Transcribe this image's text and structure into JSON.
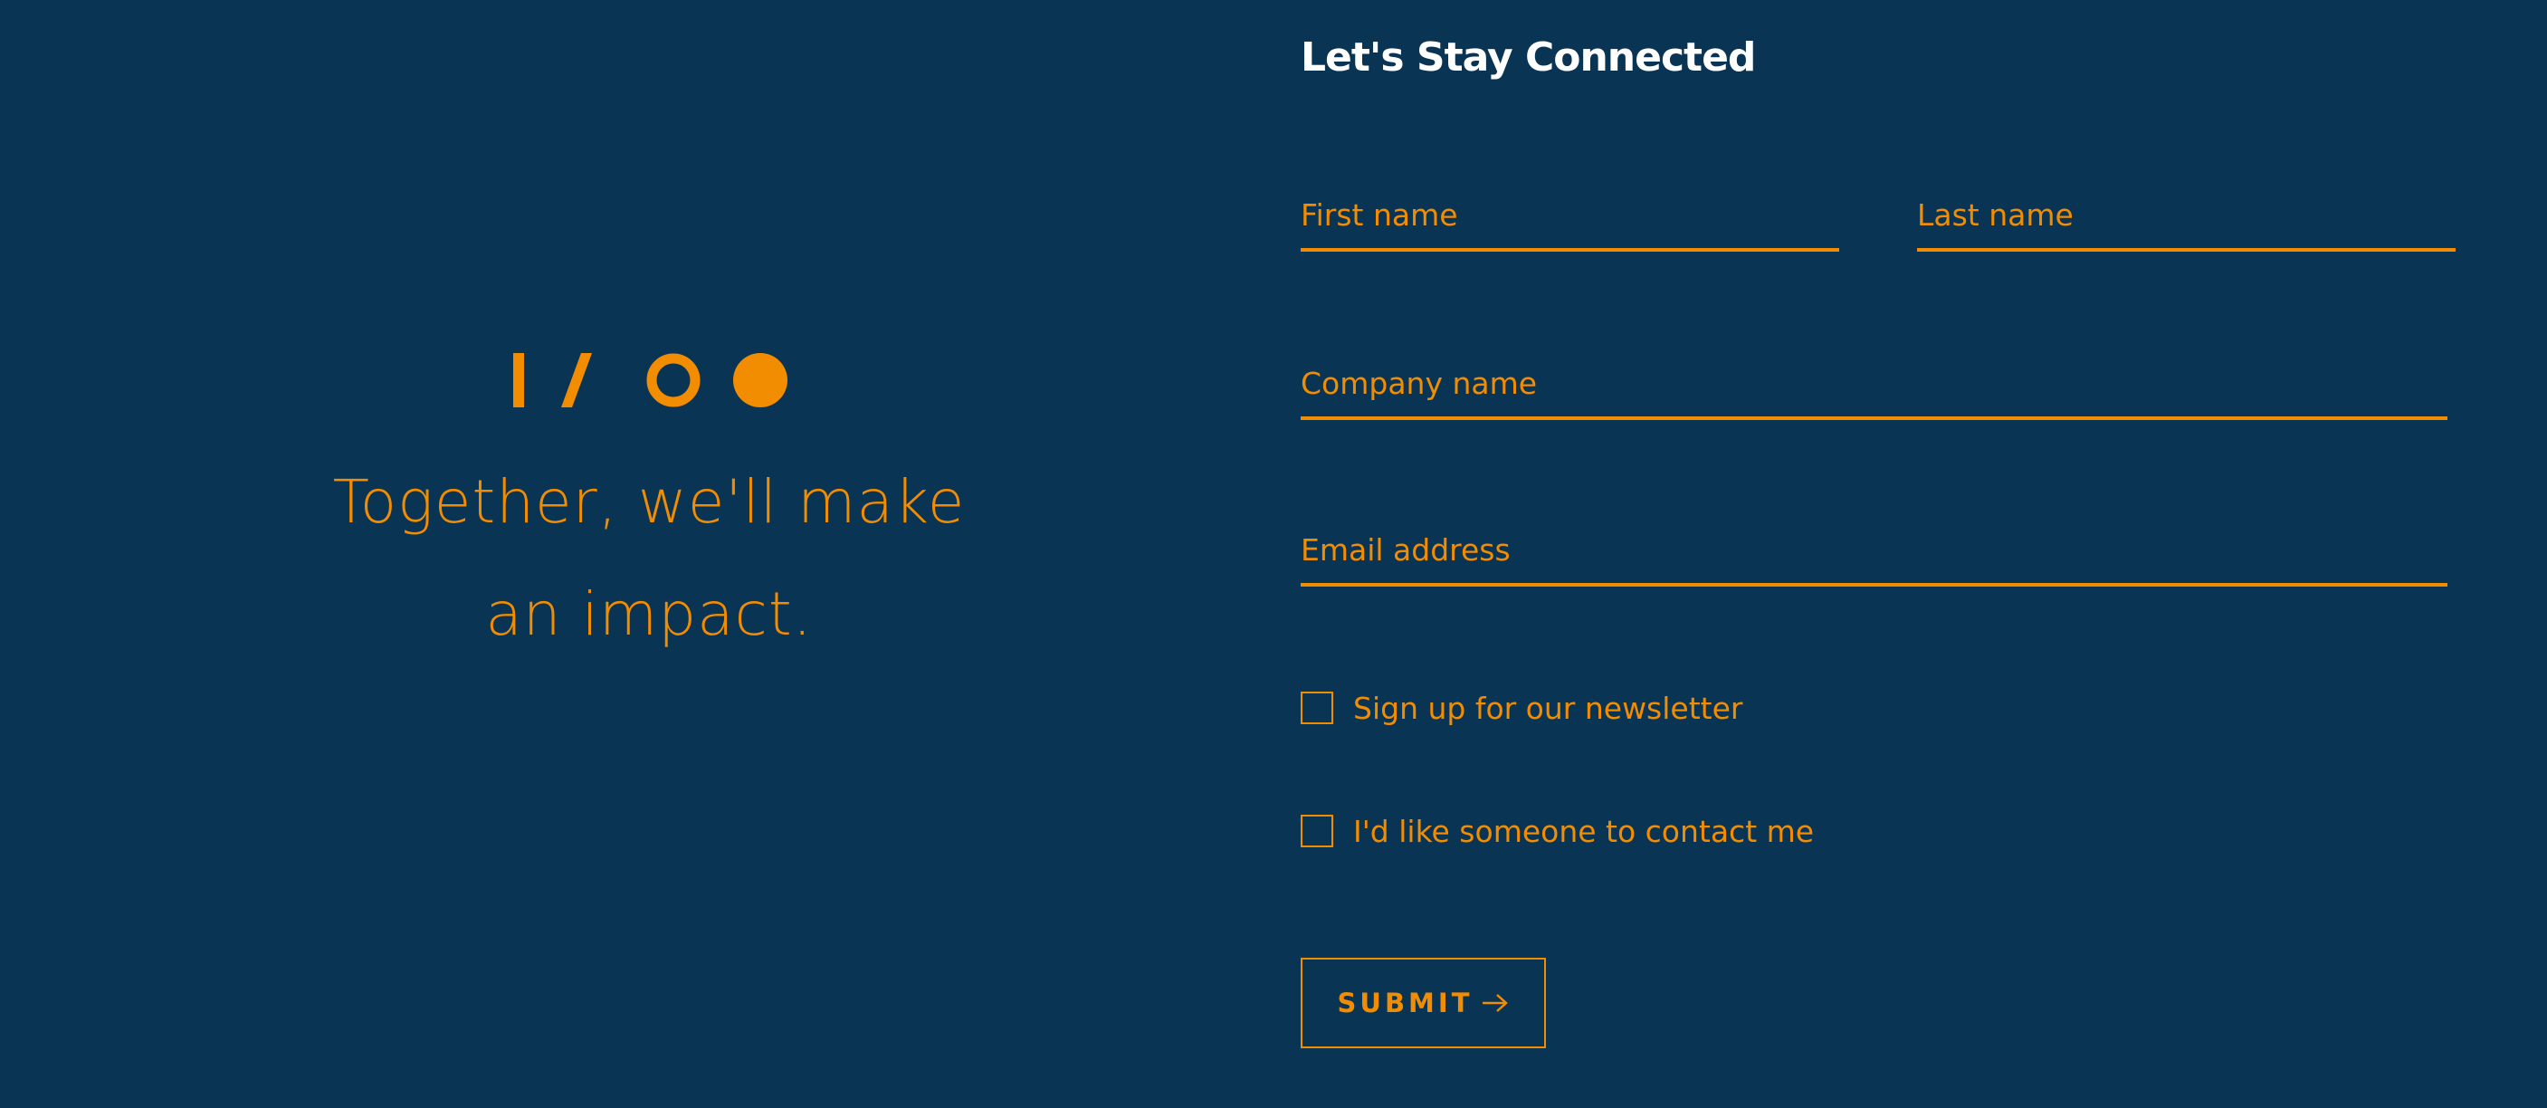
{
  "brand": {
    "logo_icon": "i-slash-o-dot-logo",
    "tagline_line1": "Together, we'll make",
    "tagline_line2": "an impact."
  },
  "form": {
    "title": "Let's Stay Connected",
    "first_name_placeholder": "First name",
    "last_name_placeholder": "Last name",
    "company_placeholder": "Company name",
    "email_placeholder": "Email address",
    "newsletter_label": "Sign up for our newsletter",
    "contact_label": "I'd like someone to contact me",
    "submit_label": "SUBMIT",
    "submit_icon": "arrow-right-icon"
  },
  "colors": {
    "background": "#0a3454",
    "accent": "#f28c00",
    "title": "#ffffff"
  }
}
